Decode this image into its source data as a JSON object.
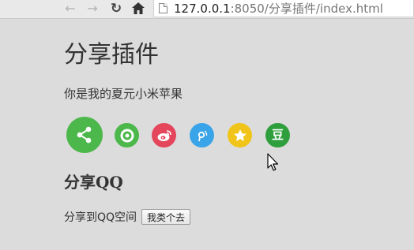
{
  "browser": {
    "back_icon": "back-arrow-icon",
    "forward_icon": "forward-arrow-icon",
    "reload_icon": "reload-icon",
    "home_icon": "home-icon",
    "url_host": "127.0.0.1",
    "url_rest": ":8050/分享插件/index.html"
  },
  "page": {
    "title": "分享插件",
    "intro": "你是我的夏元小米苹果"
  },
  "share_icons": [
    {
      "name": "share-icon",
      "color": "#4cb84b"
    },
    {
      "name": "wechat-moments-icon",
      "color": "#4cb84b"
    },
    {
      "name": "weibo-icon",
      "color": "#e4465b"
    },
    {
      "name": "tencent-weibo-icon",
      "color": "#3aa4e8"
    },
    {
      "name": "qzone-icon",
      "color": "#f0c419"
    },
    {
      "name": "douban-icon",
      "color": "#2f9e3c",
      "glyph": "豆"
    }
  ],
  "qq": {
    "heading": "分享QQ",
    "label": "分享到QQ空间",
    "button_label": "我类个去"
  }
}
